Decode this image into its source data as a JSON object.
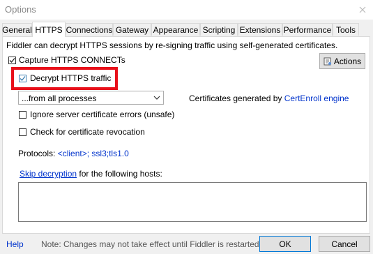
{
  "window": {
    "title": "Options"
  },
  "tabs": [
    {
      "label": "General"
    },
    {
      "label": "HTTPS"
    },
    {
      "label": "Connections"
    },
    {
      "label": "Gateway"
    },
    {
      "label": "Appearance"
    },
    {
      "label": "Scripting"
    },
    {
      "label": "Extensions"
    },
    {
      "label": "Performance"
    },
    {
      "label": "Tools"
    }
  ],
  "https": {
    "description": "Fiddler can decrypt HTTPS sessions by re-signing traffic using self-generated certificates.",
    "capture_connects": {
      "label": "Capture HTTPS CONNECTs",
      "checked": true
    },
    "actions_label": "Actions",
    "decrypt_traffic": {
      "label": "Decrypt HTTPS traffic",
      "checked": true
    },
    "process_filter": {
      "value": "...from all processes"
    },
    "cert_prefix": "Certificates generated by ",
    "cert_engine": "CertEnroll engine",
    "ignore_errors": {
      "label": "Ignore server certificate errors (unsafe)",
      "checked": false
    },
    "check_revocation": {
      "label": "Check for certificate revocation",
      "checked": false
    },
    "protocols_label": "Protocols: ",
    "protocols_value": "<client>; ssl3;tls1.0",
    "skip_link": "Skip decryption",
    "skip_suffix": " for the following hosts:",
    "skip_hosts_value": ""
  },
  "footer": {
    "help": "Help",
    "note": "Note: Changes may not take effect until Fiddler is restarted.",
    "ok": "OK",
    "cancel": "Cancel"
  },
  "colors": {
    "highlight": "#e8101a",
    "link": "#0033cc",
    "check_accent": "#3c7fb1"
  }
}
